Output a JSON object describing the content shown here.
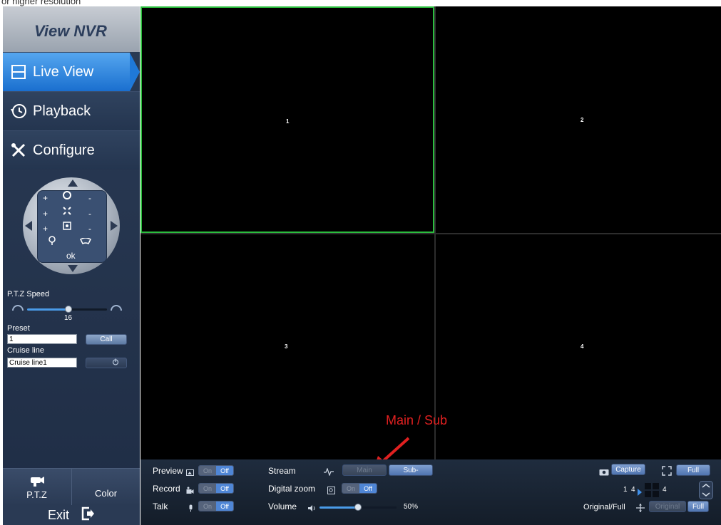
{
  "top_strip_text": "or higher resolution",
  "brand": "View NVR",
  "nav": {
    "live": "Live View",
    "playback": "Playback",
    "configure": "Configure"
  },
  "ptz": {
    "zoom_plus": "+",
    "zoom_minus": "-",
    "focus_plus": "+",
    "focus_minus": "-",
    "iris_plus": "+",
    "iris_minus": "-",
    "ok": "ok",
    "speed_label": "P.T.Z Speed",
    "speed_value": "16",
    "speed_fraction": 0.52,
    "preset_label": "Preset",
    "preset_value": "1",
    "call_label": "Call",
    "cruise_label": "Cruise line",
    "cruise_value": "Cruise line1"
  },
  "bottom_tabs": {
    "ptz": "P.T.Z",
    "color": "Color"
  },
  "exit_label": "Exit",
  "channels": [
    "1",
    "2",
    "3",
    "4"
  ],
  "controls": {
    "preview_label": "Preview",
    "record_label": "Record",
    "talk_label": "Talk",
    "stream_label": "Stream",
    "digital_zoom_label": "Digital zoom",
    "volume_label": "Volume",
    "on": "On",
    "off": "Off",
    "main": "Main",
    "sub": "Sub-",
    "volume_value": "50%",
    "volume_fraction": 0.5,
    "capture": "Capture",
    "full": "Full",
    "original_full_label": "Original/Full",
    "original": "Original",
    "full2": "Full",
    "layout_num1": "1",
    "layout_num2": "4",
    "layout_num3": "4"
  },
  "annotation": "Main / Sub",
  "colors": {
    "active_tile_border": "#2bbd3e",
    "accent_blue": "#4f86d6",
    "annotation_red": "#e02020"
  }
}
